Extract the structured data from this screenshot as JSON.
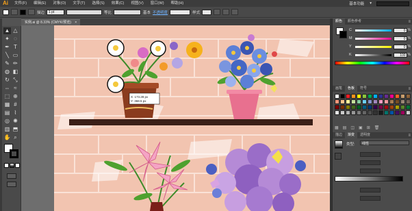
{
  "app": {
    "logo": "Ai"
  },
  "menu": {
    "items": [
      "文件(F)",
      "编辑(E)",
      "对象(O)",
      "文字(T)",
      "选择(S)",
      "效果(C)",
      "视图(V)",
      "窗口(W)",
      "帮助(H)"
    ],
    "right": [
      "基本功能",
      "▾"
    ]
  },
  "control_bar": {
    "stroke_label": "描边",
    "stroke_width": "1 pt",
    "stroke_style_label": "等比",
    "brush_label": "基本",
    "opacity_label": "不透明度",
    "style_label": "样式"
  },
  "document": {
    "tab_label": "实例.ai @ 8.33% (CMYK/预览)",
    "close": "×"
  },
  "tooltip": {
    "x": "X: 173.28 px",
    "y": "Y: 368.5 px"
  },
  "panels": {
    "color": {
      "tabs": [
        "颜色",
        "颜色参考"
      ],
      "channels": [
        {
          "ch": "C",
          "value": "0"
        },
        {
          "ch": "M",
          "value": "0"
        },
        {
          "ch": "Y",
          "value": "0"
        },
        {
          "ch": "K",
          "value": "100"
        }
      ],
      "unit": "%"
    },
    "swatches": {
      "tabs": [
        "色板",
        "画笔",
        "符号"
      ]
    },
    "stroke": {
      "tabs": [
        "描边",
        "渐变",
        "透明度"
      ],
      "type_label": "类型:",
      "type_value": "线性"
    }
  },
  "colors": {
    "wall": "#f2c4b0",
    "shelf": "#3b1f17",
    "accent": "#f7a21b"
  }
}
